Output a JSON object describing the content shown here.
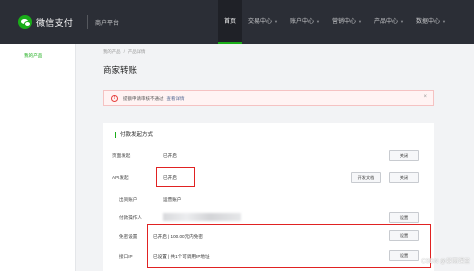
{
  "header": {
    "logo_text": "微信支付",
    "platform": "商户平台",
    "nav": [
      {
        "label": "首页",
        "active": true,
        "caret": false
      },
      {
        "label": "交易中心",
        "active": false,
        "caret": true
      },
      {
        "label": "账户中心",
        "active": false,
        "caret": true
      },
      {
        "label": "营销中心",
        "active": false,
        "caret": true
      },
      {
        "label": "产品中心",
        "active": false,
        "caret": true
      },
      {
        "label": "数据中心",
        "active": false,
        "caret": true
      }
    ]
  },
  "sidebar": {
    "items": [
      {
        "label": "我的产品"
      }
    ]
  },
  "breadcrumb": [
    "我的产品",
    "产品详情"
  ],
  "page_title": "商家转账",
  "alert": {
    "text": "提额申请审核不通过",
    "link": "查看详情",
    "close": "×"
  },
  "section": {
    "title": "付款发起方式",
    "rows": [
      {
        "label": "页面发起",
        "value": "已开启",
        "buttons": [
          "关闭"
        ]
      },
      {
        "label": "API发起",
        "value": "已开启",
        "buttons": [
          "开发文档",
          "关闭"
        ]
      },
      {
        "label": "出资账户",
        "value": "运营账户",
        "buttons": []
      },
      {
        "label": "付款操作人",
        "value": "",
        "buttons": [
          "设置"
        ]
      },
      {
        "label": "免密设置",
        "value": "已开启 | 100.00元内免密",
        "buttons": [
          "设置"
        ]
      },
      {
        "label": "接口IP",
        "value": "已设置 | 共1个可调用IP地址",
        "buttons": [
          "设置"
        ]
      }
    ]
  },
  "watermark": "CSDN @暴雨课堂"
}
